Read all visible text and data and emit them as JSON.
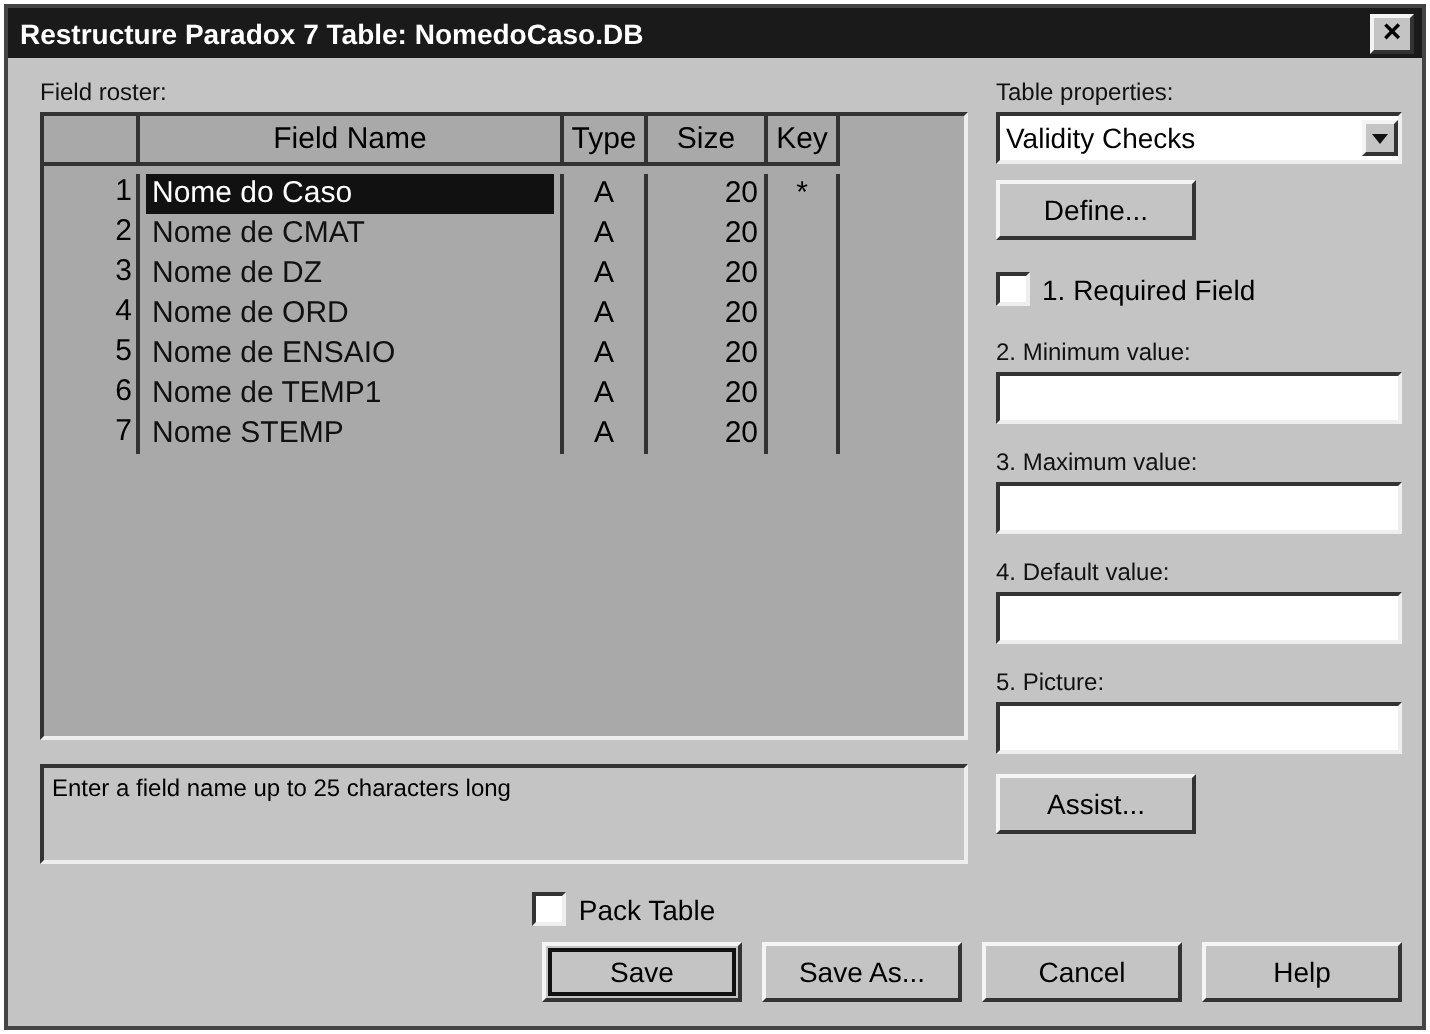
{
  "window": {
    "title": "Restructure Paradox 7 Table: NomedoCaso.DB",
    "close": "×"
  },
  "field_roster": {
    "label": "Field roster:",
    "columns": [
      "Field Name",
      "Type",
      "Size",
      "Key"
    ],
    "rows": [
      {
        "number": "1",
        "name": "Nome do Caso",
        "type": "A",
        "size": "20",
        "key": "*",
        "selected": true
      },
      {
        "number": "2",
        "name": "Nome de CMAT",
        "type": "A",
        "size": "20",
        "selected": false
      },
      {
        "number": "3",
        "name": "Nome de DZ",
        "type": "A",
        "size": "20",
        "selected": false
      },
      {
        "number": "4",
        "name": "Nome de ORD",
        "type": "A",
        "size": "20",
        "selected": false
      },
      {
        "number": "5",
        "name": "Nome de ENSAIO",
        "type": "A",
        "size": "20",
        "selected": false
      },
      {
        "number": "6",
        "name": "Nome de TEMP1",
        "type": "A",
        "size": "20",
        "selected": false
      },
      {
        "number": "7",
        "name": "Nome STEMP",
        "type": "A",
        "size": "20",
        "selected": false
      }
    ]
  },
  "hint": "Enter a field name up to 25 characters long",
  "pack_table": {
    "label": "Pack Table",
    "checked": false
  },
  "table_properties": {
    "label": "Table properties:",
    "value": "Validity Checks",
    "define_button": "Define...",
    "required_field": {
      "label": "1. Required Field",
      "checked": false
    },
    "fields": [
      {
        "label": "2. Minimum value:"
      },
      {
        "label": "3. Maximum value:"
      },
      {
        "label": "4. Default value:"
      },
      {
        "label": "5. Picture:"
      }
    ],
    "assist_button": "Assist..."
  },
  "buttons": [
    {
      "label": "Save",
      "default": true
    },
    {
      "label": "Save As...",
      "default": false
    },
    {
      "label": "Cancel",
      "default": false
    },
    {
      "label": "Help",
      "default": false
    }
  ]
}
